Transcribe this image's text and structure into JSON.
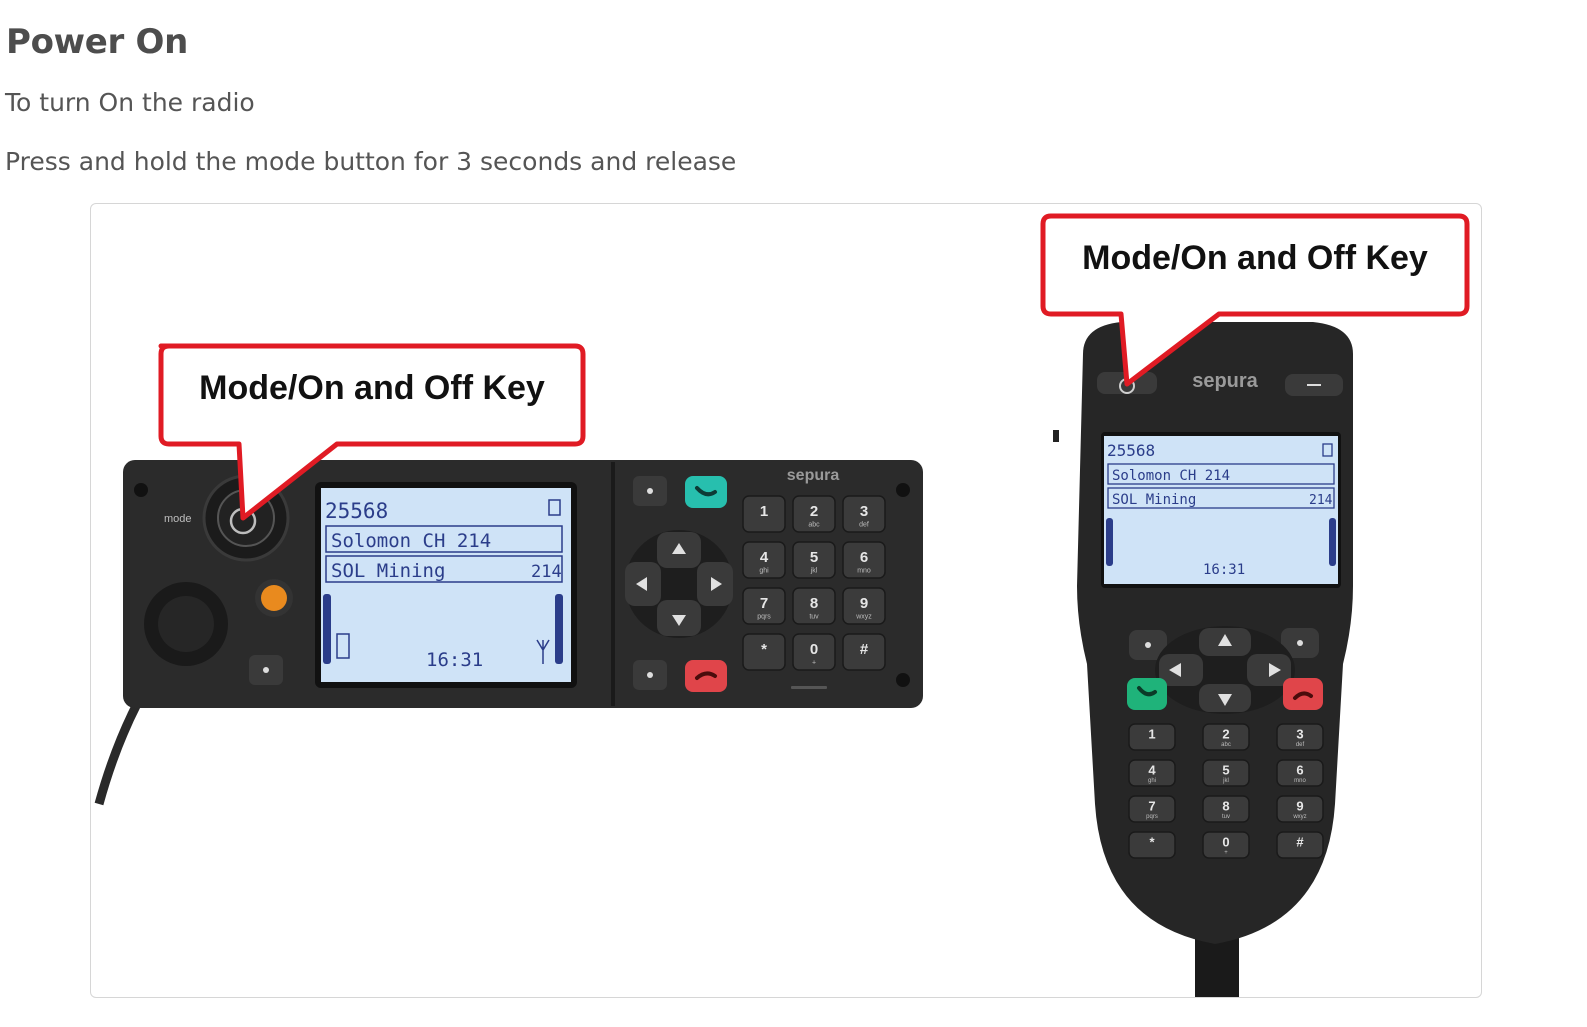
{
  "title": "Power On",
  "intro": "To turn On the radio",
  "instruction": "Press and hold the mode button for 3 seconds and release",
  "figure": {
    "callout_left": "Mode/On and Off Key",
    "callout_right": "Mode/On and Off Key",
    "brand_left": "sepura",
    "brand_right": "sepura",
    "mode_label": "mode",
    "lcd": {
      "id": "25568",
      "talkgroup": "Solomon CH 214",
      "folder": "SOL Mining",
      "folder_num": "214",
      "time": "16:31"
    },
    "keypad": [
      {
        "num": "1",
        "sub": ""
      },
      {
        "num": "2",
        "sub": "abc"
      },
      {
        "num": "3",
        "sub": "def"
      },
      {
        "num": "4",
        "sub": "ghi"
      },
      {
        "num": "5",
        "sub": "jkl"
      },
      {
        "num": "6",
        "sub": "mno"
      },
      {
        "num": "7",
        "sub": "pqrs"
      },
      {
        "num": "8",
        "sub": "tuv"
      },
      {
        "num": "9",
        "sub": "wxyz"
      },
      {
        "num": "*",
        "sub": ""
      },
      {
        "num": "0",
        "sub": "+"
      },
      {
        "num": "#",
        "sub": ""
      }
    ],
    "colors": {
      "callout_border": "#e01b24",
      "lcd_bg": "#cfe3f7",
      "device_body": "#2a2a2a",
      "call_green": "#1fb37a",
      "end_red": "#e0454a"
    }
  }
}
